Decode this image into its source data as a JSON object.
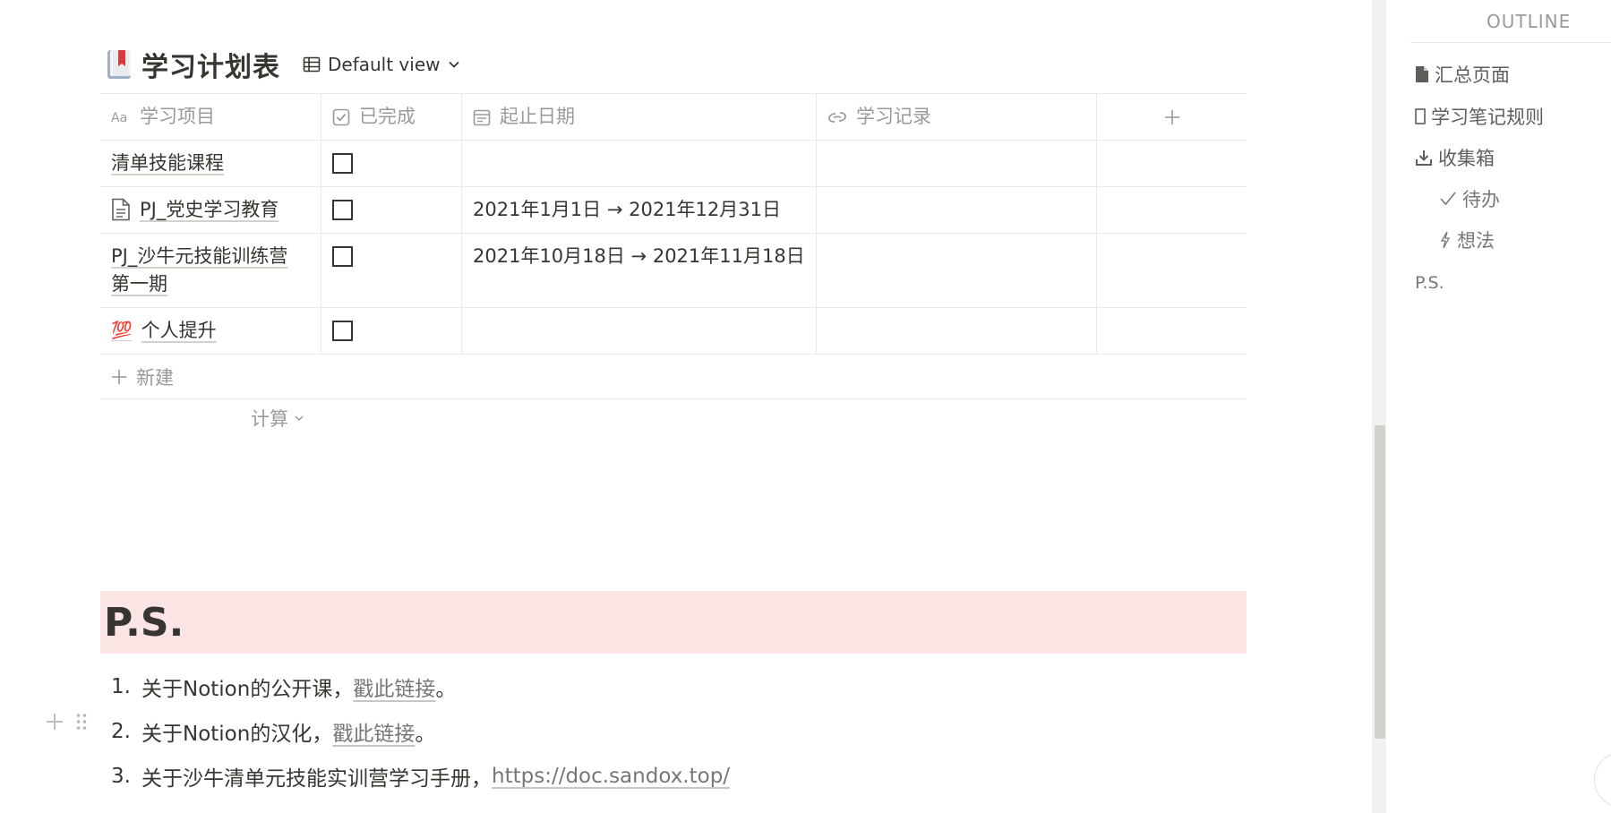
{
  "database": {
    "title": "学习计划表",
    "view_label": "Default view",
    "columns": [
      "学习项目",
      "已完成",
      "起止日期",
      "学习记录"
    ],
    "rows": [
      {
        "title": "清单技能课程",
        "has_icon": false,
        "done": false,
        "date": ""
      },
      {
        "title": "PJ_党史学习教育",
        "has_icon": true,
        "icon": "page-icon",
        "done": false,
        "date": "2021年1月1日 → 2021年12月31日"
      },
      {
        "title": "PJ_沙牛元技能训练营第一期",
        "title_line1": "PJ_沙牛元技能训练营",
        "title_line2": "第一期",
        "has_icon": false,
        "done": false,
        "date": "2021年10月18日 → 2021年11月18日"
      },
      {
        "title": "个人提升",
        "has_icon": true,
        "icon": "hundred-points-emoji",
        "emoji": "💯",
        "done": false,
        "date": ""
      }
    ],
    "new_row_label": "新建",
    "calc_label": "计算"
  },
  "ps": {
    "heading": "P.S.",
    "heading_bg": "#fbe4e4",
    "items": [
      {
        "num": "1.",
        "text": "关于Notion的公开课，",
        "link": "戳此链接",
        "suffix": "。"
      },
      {
        "num": "2.",
        "text": "关于Notion的汉化，",
        "link": "戳此链接",
        "suffix": "。"
      },
      {
        "num": "3.",
        "text": "关于沙牛清单元技能实训营学习手册，",
        "link": "https://doc.sandox.top/",
        "suffix": ""
      }
    ]
  },
  "outline": {
    "title": "OUTLINE",
    "items": [
      {
        "label": "汇总页面",
        "icon": "page-icon"
      },
      {
        "label": "学习笔记规则",
        "icon": "blank-page-icon"
      },
      {
        "label": "收集箱",
        "icon": "download-tray-icon"
      },
      {
        "label": "待办",
        "icon": "check-icon"
      },
      {
        "label": "想法",
        "icon": "lightning-icon"
      },
      {
        "label": "P.S.",
        "icon": ""
      }
    ]
  }
}
